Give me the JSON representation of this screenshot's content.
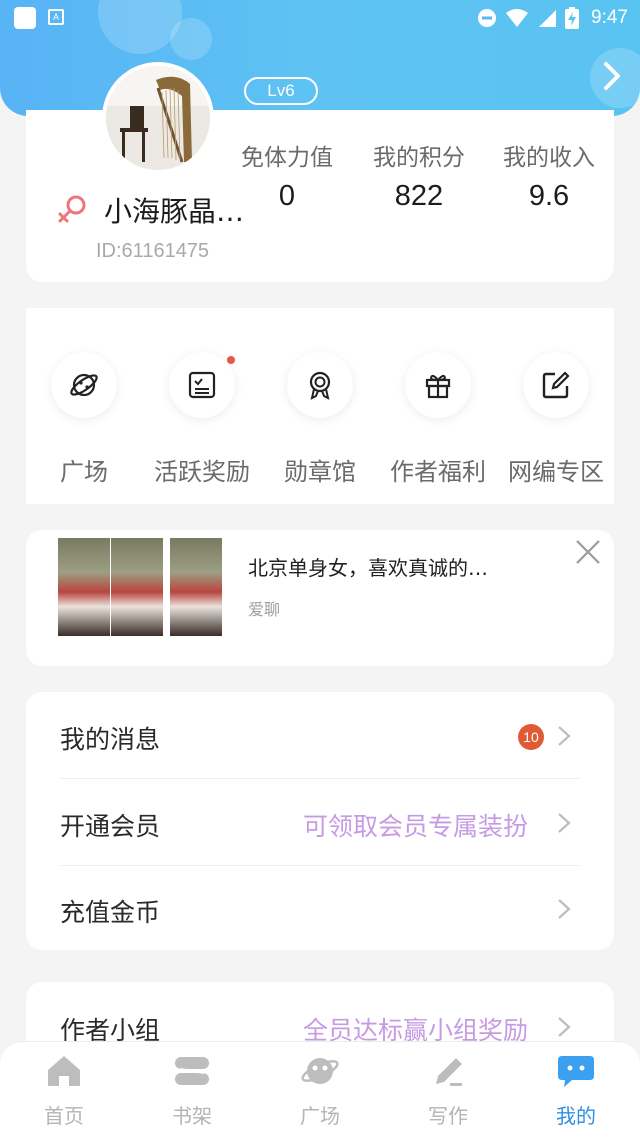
{
  "status_bar": {
    "time": "9:47",
    "left_icons": [
      "white-square-icon",
      "store-a-icon"
    ],
    "right_icons": [
      "do-not-disturb-icon",
      "wifi-icon",
      "signal-icon",
      "battery-charging-icon"
    ],
    "store_glyph": "A"
  },
  "colors": {
    "header_gradient_start": "#58b3f5",
    "header_gradient_end": "#59c3f2",
    "accent_blue": "#2f8fe6",
    "hint_purple": "#c79ae4",
    "badge_red": "#e05a36",
    "female_pink": "#f0757a"
  },
  "profile": {
    "level": "Lv6",
    "nickname": "小海豚晶…",
    "user_id": "ID:61161475",
    "gender_icon": "female-icon",
    "stats": [
      {
        "label": "免体力值",
        "value": "0"
      },
      {
        "label": "我的积分",
        "value": "822"
      },
      {
        "label": "我的收入",
        "value": "9.6"
      }
    ]
  },
  "actions": [
    {
      "label": "广场",
      "icon": "planet-icon",
      "dot": false
    },
    {
      "label": "活跃奖励",
      "icon": "checklist-icon",
      "dot": true
    },
    {
      "label": "勋章馆",
      "icon": "medal-icon",
      "dot": false
    },
    {
      "label": "作者福利",
      "icon": "gift-icon",
      "dot": false
    },
    {
      "label": "网编专区",
      "icon": "edit-icon",
      "dot": false
    }
  ],
  "ad": {
    "title": "北京单身女，喜欢真诚的…",
    "subtitle": "爱聊"
  },
  "menu": {
    "messages": {
      "label": "我的消息",
      "badge": "10"
    },
    "vip": {
      "label": "开通会员",
      "hint": "可领取会员专属装扮"
    },
    "recharge": {
      "label": "充值金币"
    },
    "author_group": {
      "label": "作者小组",
      "hint": "全员达标赢小组奖励"
    }
  },
  "bottom_nav": [
    {
      "label": "首页",
      "icon": "home-icon",
      "active": false
    },
    {
      "label": "书架",
      "icon": "bookshelf-icon",
      "active": false
    },
    {
      "label": "广场",
      "icon": "planet-icon",
      "active": false
    },
    {
      "label": "写作",
      "icon": "pen-icon",
      "active": false
    },
    {
      "label": "我的",
      "icon": "chat-bubble-icon",
      "active": true
    }
  ]
}
